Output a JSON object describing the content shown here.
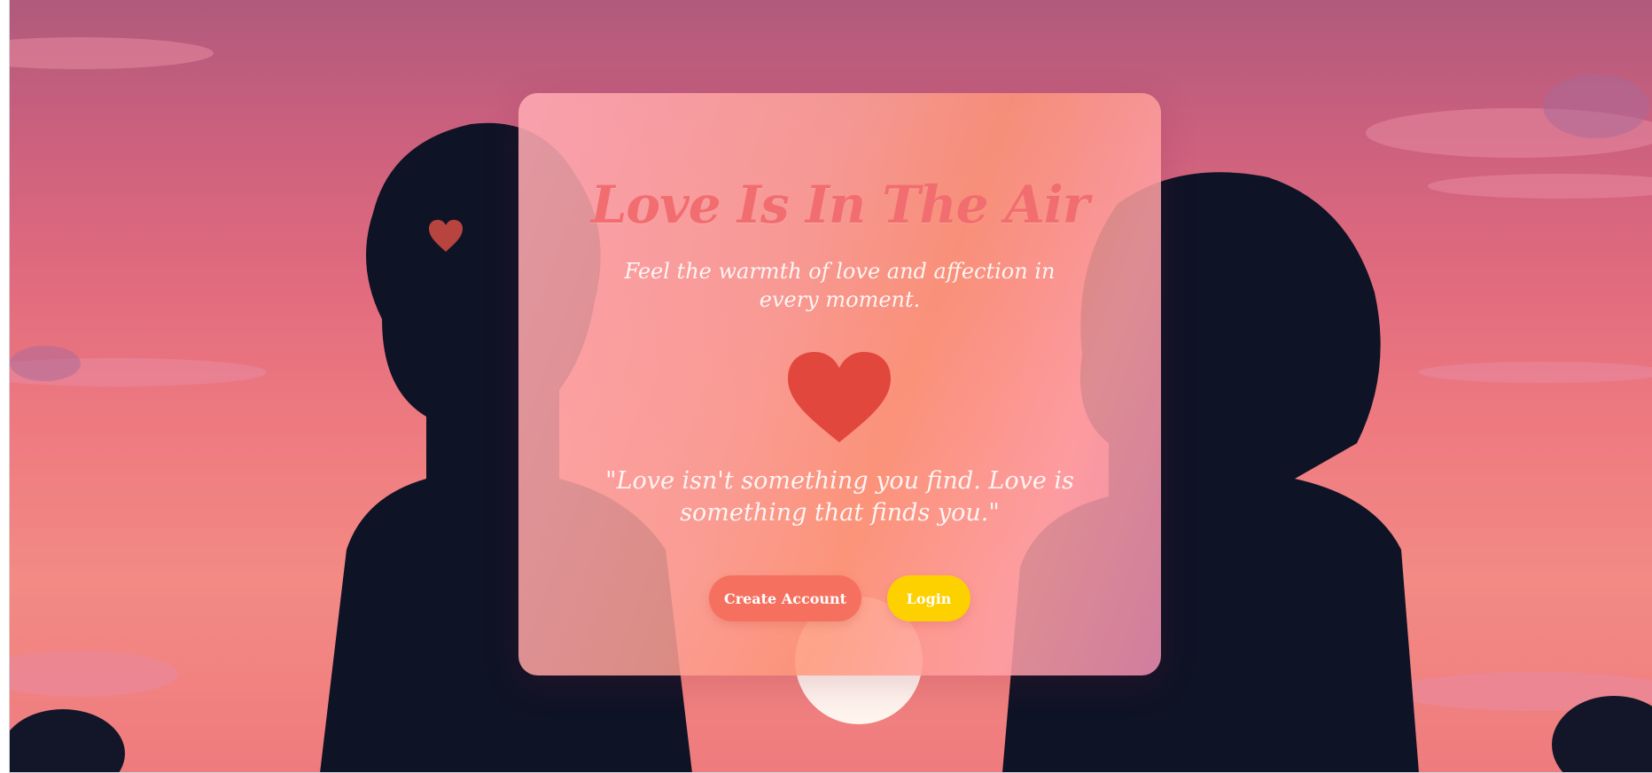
{
  "hero": {
    "title": "Love Is In The Air",
    "subtitle": "Feel the warmth of love and affection in every moment.",
    "quote": "\"Love isn't something you find. Love is something that finds you.\""
  },
  "actions": {
    "create_account_label": "Create Account",
    "login_label": "Login"
  },
  "icons": {
    "center": "heart-icon",
    "floating": "heart-icon"
  },
  "colors": {
    "title": "#f26d70",
    "create_button": "#f6705f",
    "login_button": "#fdd000",
    "heart": "#e2473e"
  }
}
